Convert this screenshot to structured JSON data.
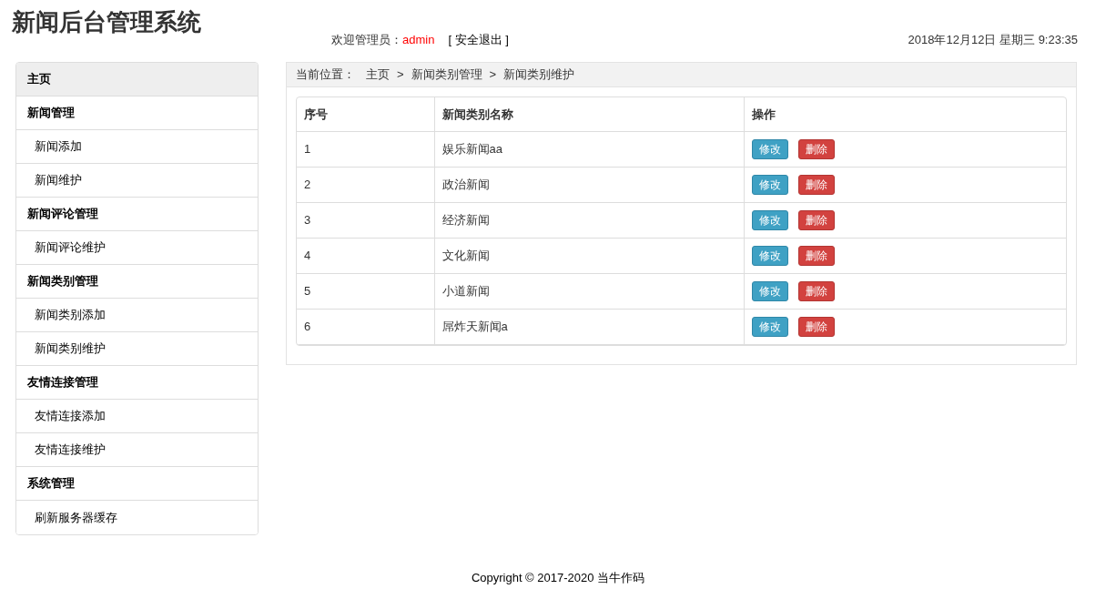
{
  "header": {
    "title": "新闻后台管理系统",
    "welcome_label": "欢迎管理员：",
    "username": "admin",
    "logout": "[ 安全退出 ]",
    "datetime": "2018年12月12日 星期三 9:23:35"
  },
  "sidebar": {
    "items": [
      {
        "kind": "home",
        "label": "主页"
      },
      {
        "kind": "group",
        "label": "新闻管理"
      },
      {
        "kind": "link",
        "label": "新闻添加"
      },
      {
        "kind": "link",
        "label": "新闻维护"
      },
      {
        "kind": "group",
        "label": "新闻评论管理"
      },
      {
        "kind": "link",
        "label": "新闻评论维护"
      },
      {
        "kind": "group",
        "label": "新闻类别管理"
      },
      {
        "kind": "link",
        "label": "新闻类别添加"
      },
      {
        "kind": "link",
        "label": "新闻类别维护"
      },
      {
        "kind": "group",
        "label": "友情连接管理"
      },
      {
        "kind": "link",
        "label": "友情连接添加"
      },
      {
        "kind": "link",
        "label": "友情连接维护"
      },
      {
        "kind": "group",
        "label": "系统管理"
      },
      {
        "kind": "link",
        "label": "刷新服务器缓存"
      }
    ]
  },
  "breadcrumb": {
    "label": "当前位置：",
    "separator": ">",
    "items": [
      "主页",
      "新闻类别管理",
      "新闻类别维护"
    ]
  },
  "table": {
    "columns": [
      "序号",
      "新闻类别名称",
      "操作"
    ],
    "rows": [
      {
        "index": "1",
        "name": "娱乐新闻aa",
        "actions": [
          "修改",
          "删除"
        ]
      },
      {
        "index": "2",
        "name": "政治新闻",
        "actions": [
          "修改",
          "删除"
        ]
      },
      {
        "index": "3",
        "name": "经济新闻",
        "actions": [
          "修改",
          "删除"
        ]
      },
      {
        "index": "4",
        "name": "文化新闻",
        "actions": [
          "修改",
          "删除"
        ]
      },
      {
        "index": "5",
        "name": "小道新闻",
        "actions": [
          "修改",
          "删除"
        ]
      },
      {
        "index": "6",
        "name": "屌炸天新闻a",
        "actions": [
          "修改",
          "删除"
        ]
      }
    ]
  },
  "footer": "Copyright © 2017-2020 当牛作码"
}
